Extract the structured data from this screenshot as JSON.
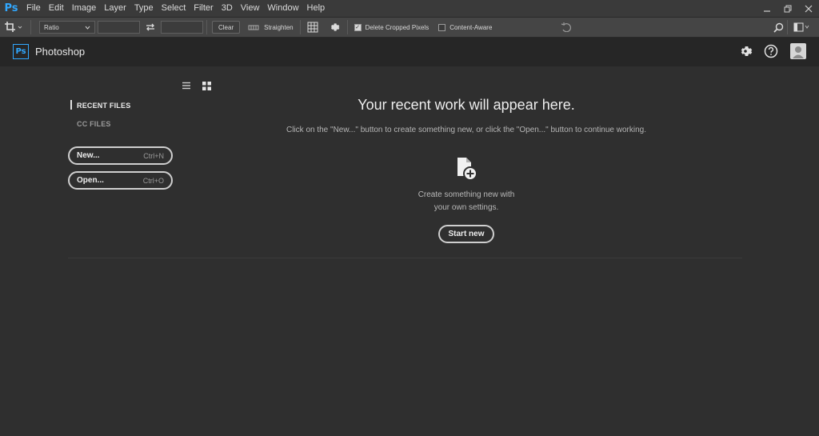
{
  "menubar": {
    "logo": "Ps",
    "items": [
      "File",
      "Edit",
      "Image",
      "Layer",
      "Type",
      "Select",
      "Filter",
      "3D",
      "View",
      "Window",
      "Help"
    ]
  },
  "options_bar": {
    "ratio_select": "Ratio",
    "clear_label": "Clear",
    "straighten_label": "Straighten",
    "delete_cropped_label": "Delete Cropped Pixels",
    "delete_cropped_checked": true,
    "content_aware_label": "Content-Aware",
    "content_aware_checked": false
  },
  "header": {
    "logo": "Ps",
    "app_name": "Photoshop"
  },
  "sidebar": {
    "recent_files": "RECENT FILES",
    "cc_files": "CC FILES",
    "new_label": "New...",
    "new_shortcut": "Ctrl+N",
    "open_label": "Open...",
    "open_shortcut": "Ctrl+O"
  },
  "main": {
    "headline": "Your recent work will appear here.",
    "subline": "Click on the \"New...\" button to create something new, or click the \"Open...\" button to continue working.",
    "create_line1": "Create something new with",
    "create_line2": "your own settings.",
    "start_new": "Start new"
  },
  "colors": {
    "accent": "#31a8ff",
    "background": "#2f2f2f",
    "header": "#262626"
  }
}
